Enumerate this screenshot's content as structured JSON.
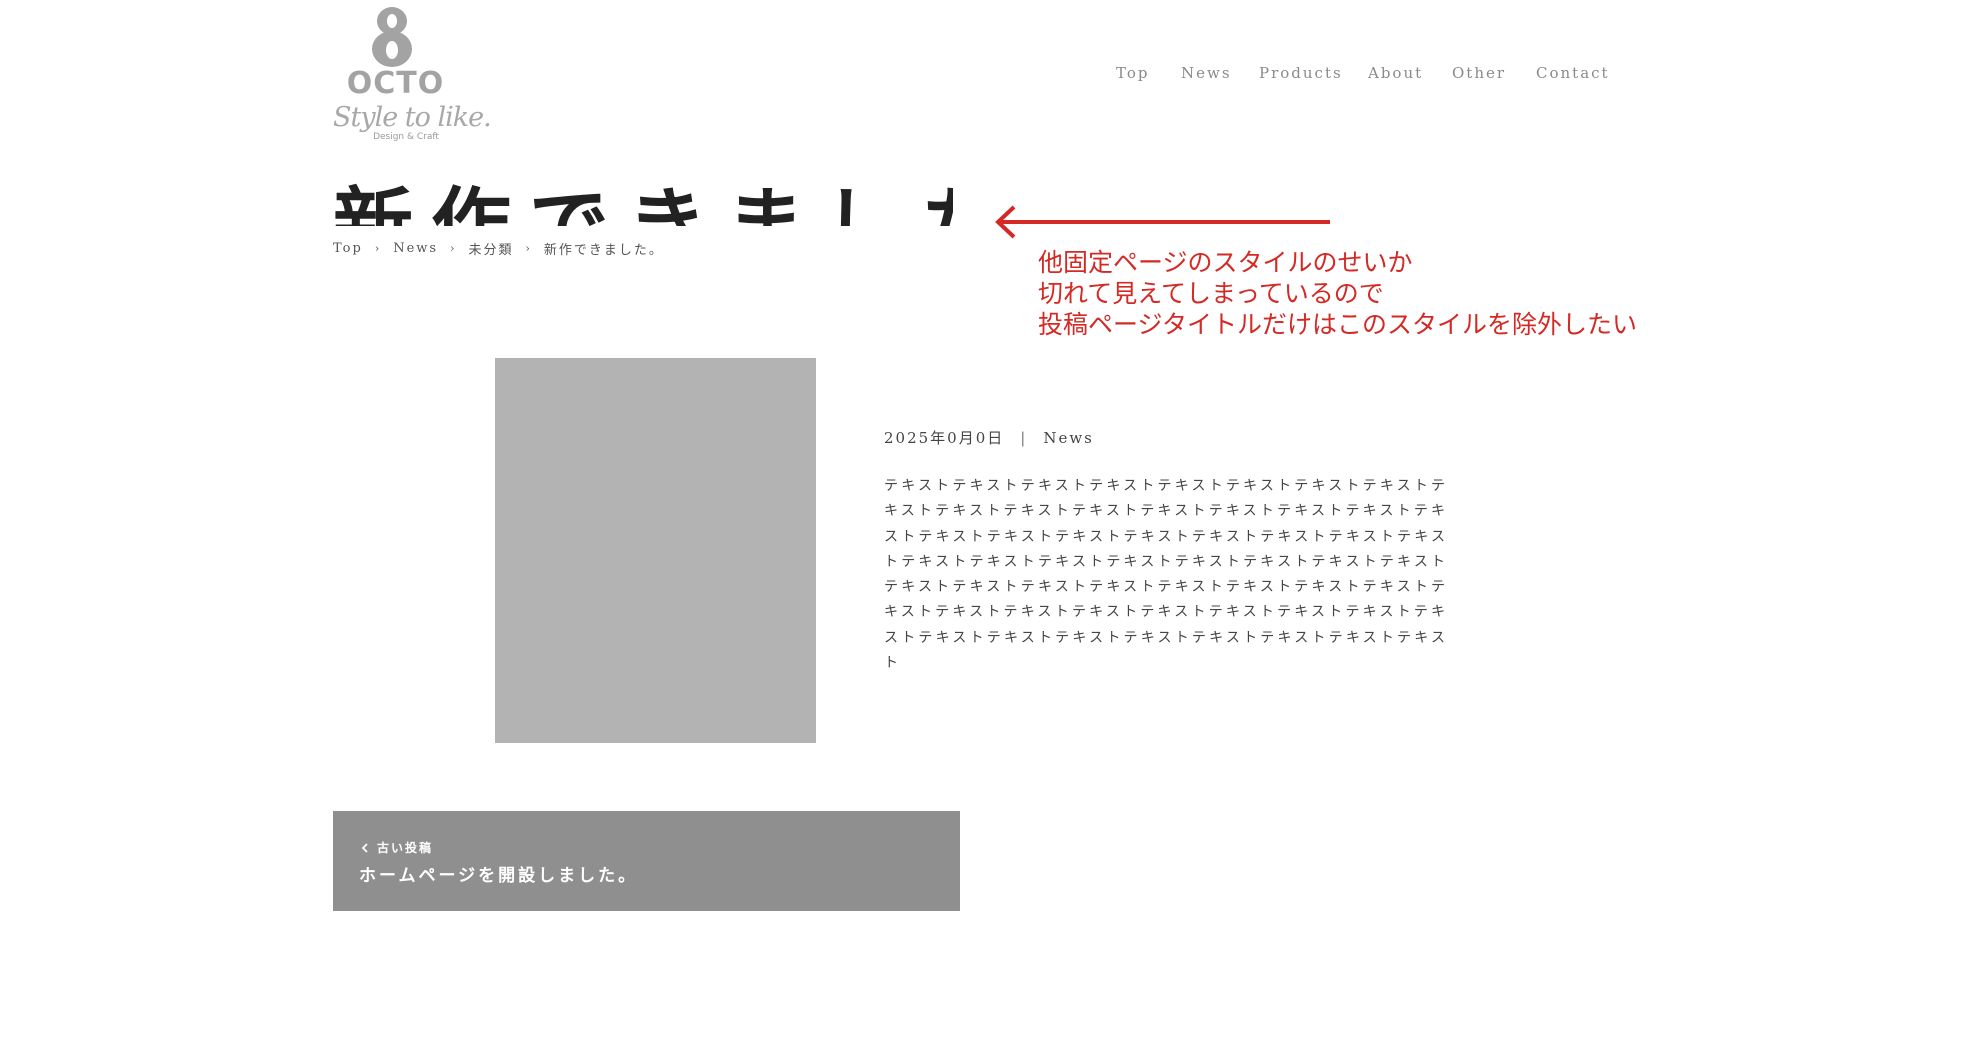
{
  "logo": {
    "name": "OCTO",
    "tagline": "Style to like.",
    "sub": "Design & Craft"
  },
  "nav": {
    "items": [
      {
        "label": "Top"
      },
      {
        "label": "News"
      },
      {
        "label": "Products"
      },
      {
        "label": "About"
      },
      {
        "label": "Other"
      },
      {
        "label": "Contact"
      }
    ]
  },
  "page": {
    "title": "新作できました"
  },
  "breadcrumb": {
    "items": [
      "Top",
      "News",
      "未分類",
      "新作できました。"
    ]
  },
  "annotation": {
    "lines": [
      "他固定ページのスタイルのせいか",
      "切れて見えてしまっているので",
      "投稿ページタイトルだけはこのスタイルを除外したい"
    ],
    "color": "#d42a26"
  },
  "post": {
    "date": "2025年0月0日",
    "divider": "|",
    "category": "News",
    "body": "テキストテキストテキストテキストテキストテキストテキストテキストテキストテキストテキストテキストテキストテキストテキストテキストテキストテキストテキストテキストテキストテキストテキストテキストテキストテキストテキストテキストテキストテキストテキストテキストテキストテキストテキストテキストテキストテキストテキストテキストテキストテキストテキストテキストテキストテキストテキストテキストテキストテキストテキストテキストテキストテキストテキストテキストテキストテキスト"
  },
  "prev_post": {
    "label": "古い投稿",
    "title": "ホームページを開設しました。"
  },
  "colors": {
    "image_placeholder": "#b3b3b4",
    "card_bg": "#8f8f8f"
  }
}
